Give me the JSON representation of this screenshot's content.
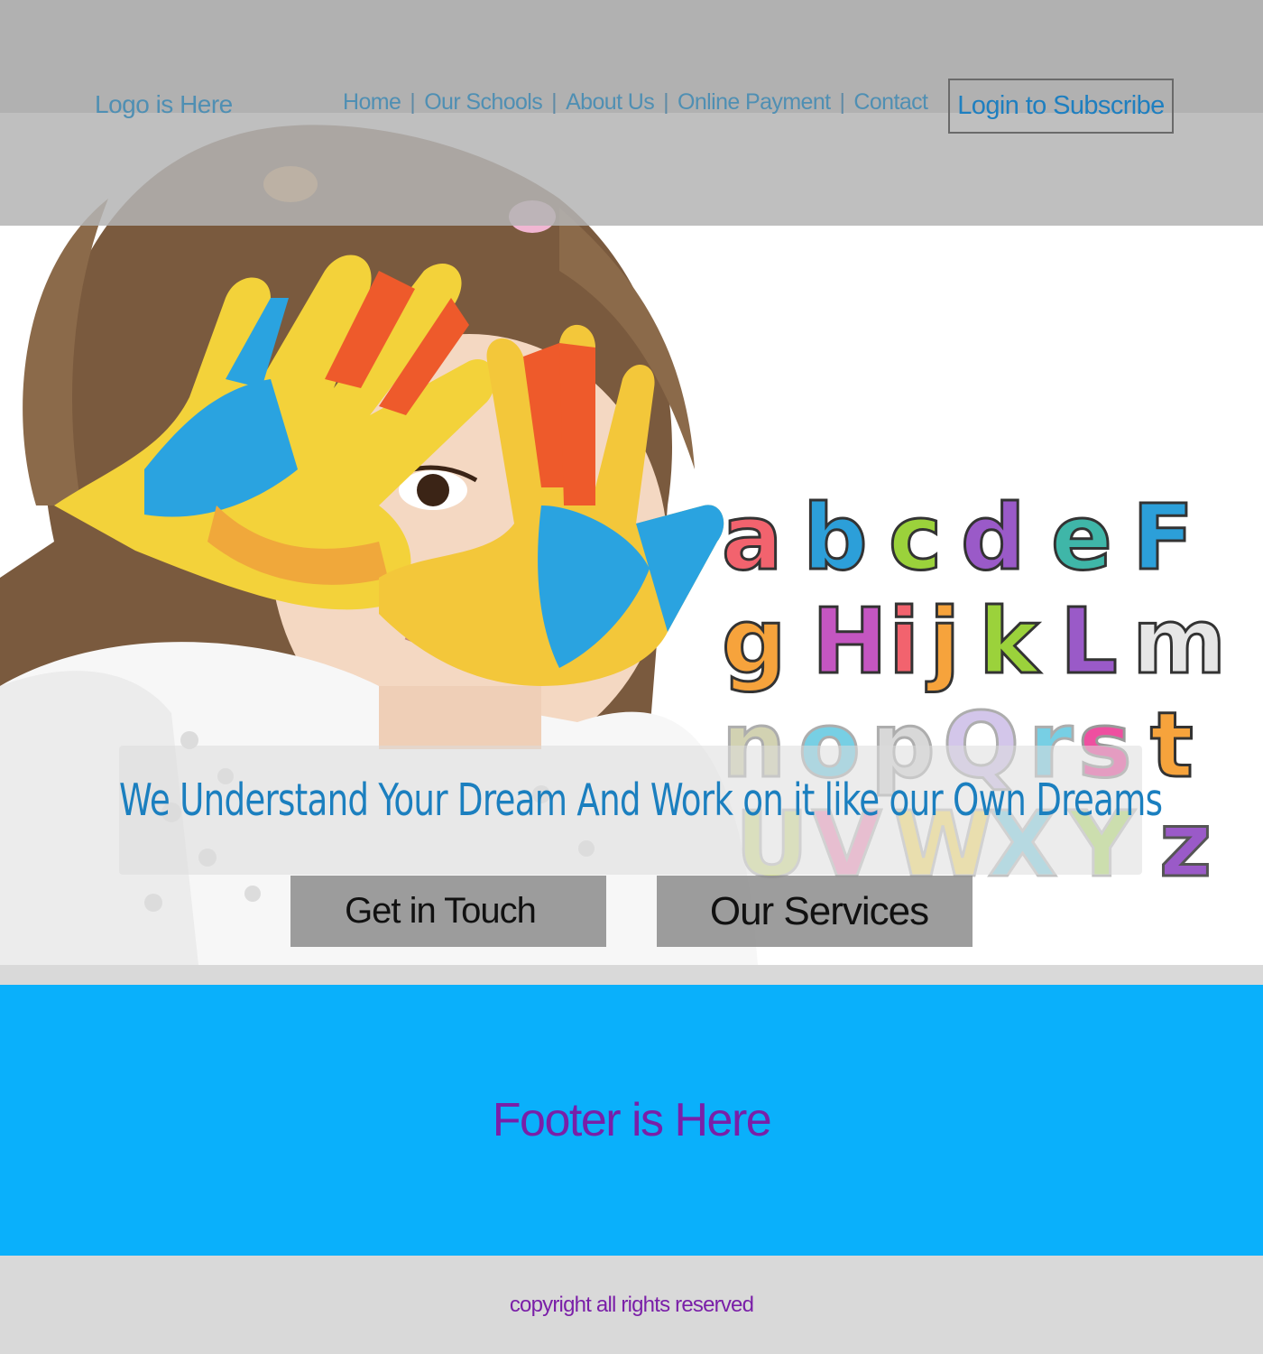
{
  "header": {
    "logo_text": "Logo is Here",
    "nav": [
      {
        "label": "Home"
      },
      {
        "label": "Our Schools"
      },
      {
        "label": "About Us"
      },
      {
        "label": "Online Payment"
      },
      {
        "label": "Contact"
      }
    ],
    "nav_separator": "|",
    "login_label": "Login to Subscribe"
  },
  "hero": {
    "image_description_icon": "child-painted-hands-photo",
    "alphabet_rows": [
      "abcdef",
      "gHijkLm",
      "nopQrst",
      "UVWXYz"
    ],
    "tagline": "We Understand Your Dream And Work on it like our Own Dreams",
    "buttons": {
      "get_in_touch": "Get in Touch",
      "our_services": "Our Services"
    }
  },
  "footer": {
    "title": "Footer is Here",
    "copyright": "copyright all rights reserved"
  },
  "colors": {
    "header_gray": "#aaaaaa",
    "link_blue": "#4f8fb3",
    "tagline_blue": "#1b7fbf",
    "footer_blue": "#0ab0fb",
    "footer_text_purple": "#7a1fa8"
  }
}
